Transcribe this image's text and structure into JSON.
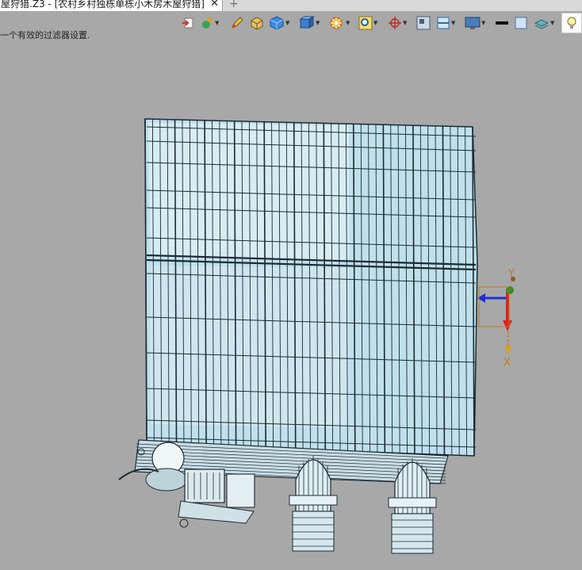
{
  "tab": {
    "title": "屋狩猎.Z3 - [农村乡村独栋单栋小木房木屋狩猎]",
    "close_glyph": "✕",
    "new_glyph": "+"
  },
  "toolbar": {
    "items": [
      {
        "name": "filter-icon",
        "dropdown": true
      },
      {
        "name": "snap-icon",
        "dropdown": true
      },
      {
        "name": "pencil-icon",
        "dropdown": true
      },
      {
        "name": "solid-box-icon",
        "dropdown": false
      },
      {
        "name": "blue-cube-icon",
        "dropdown": true
      },
      {
        "name": "view-cube-icon",
        "dropdown": true
      },
      {
        "name": "render-mode-icon",
        "dropdown": true
      },
      {
        "name": "zoom-fit-icon",
        "dropdown": true
      },
      {
        "name": "axis-triad-icon",
        "dropdown": true
      },
      {
        "name": "grid-icon",
        "dropdown": false
      },
      {
        "name": "section-icon",
        "dropdown": true
      },
      {
        "name": "display-icon",
        "dropdown": true
      },
      {
        "name": "line-color-icon",
        "dropdown": false
      },
      {
        "name": "background-color-icon",
        "dropdown": false
      },
      {
        "name": "layer-icon",
        "dropdown": true
      },
      {
        "name": "light-bulb-icon",
        "dropdown": true
      }
    ]
  },
  "status": {
    "message": "一个有效的过滤器设置."
  },
  "viewport": {
    "triad_labels": {
      "y": "Y",
      "x": "X"
    },
    "colors": {
      "background": "#a8a8a8",
      "wireframe": "#1c2a33",
      "glass": "#bfe0ec",
      "y_axis": "#2c8f2c",
      "x_axis": "#e02020",
      "z_axis": "#2030d0",
      "label": "#c07a18"
    }
  }
}
